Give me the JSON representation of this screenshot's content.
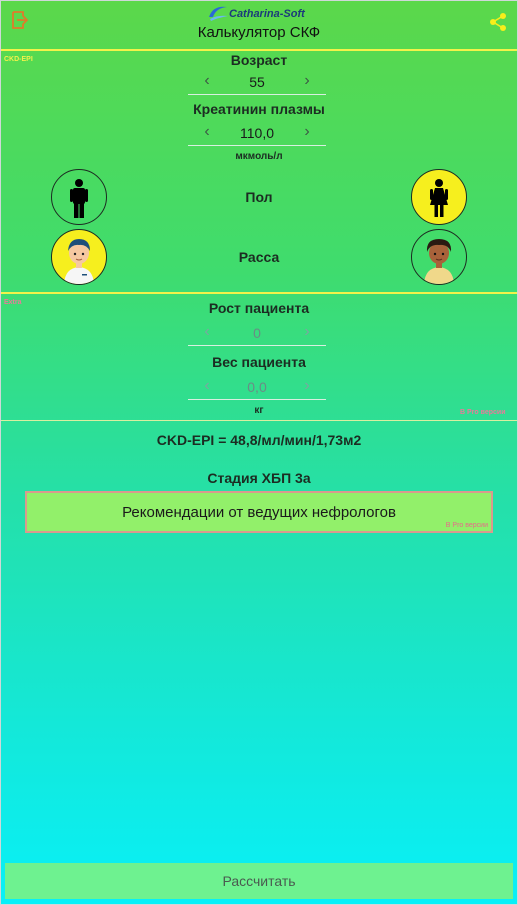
{
  "app": {
    "logo_text": "Catharina-Soft",
    "title": "Калькулятор  СКФ"
  },
  "sections": {
    "main_tag": "CKD-EPI",
    "extra_tag": "Extra",
    "pro_tag": "В Pro версии"
  },
  "age": {
    "label": "Возраст",
    "value": "55"
  },
  "creatinine": {
    "label": "Креатинин плазмы",
    "value": "110,0",
    "unit": "мкмоль/л"
  },
  "sex": {
    "label": "Пол"
  },
  "race": {
    "label": "Расса"
  },
  "height": {
    "label": "Рост пациента",
    "value": "0"
  },
  "weight": {
    "label": "Вес пациента",
    "value": "0,0",
    "unit": "кг"
  },
  "result": {
    "gfr": "CKD-EPI = 48,8/мл/мин/1,73м2",
    "stage": "Стадия ХБП 3а"
  },
  "recommendations": {
    "label": "Рекомендации от ведущих нефрологов",
    "pro": "В Pro версии"
  },
  "calculate": {
    "label": "Рассчитать"
  },
  "colors": {
    "divider": "#f2f24a",
    "selected_circle": "#f6ef1e",
    "button": "#6ef290"
  }
}
